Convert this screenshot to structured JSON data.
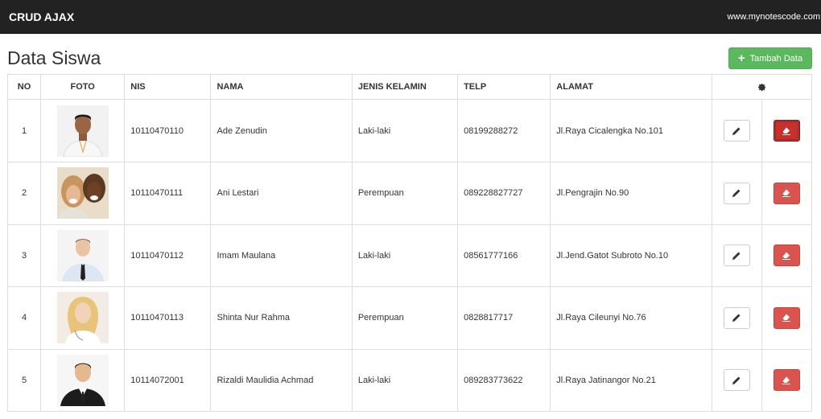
{
  "navbar": {
    "brand": "CRUD AJAX",
    "site": "www.mynotescode.com"
  },
  "page": {
    "title": "Data Siswa",
    "add_label": "Tambah Data"
  },
  "table": {
    "headers": {
      "no": "NO",
      "foto": "FOTO",
      "nis": "NIS",
      "nama": "NAMA",
      "jk": "JENIS KELAMIN",
      "telp": "TELP",
      "alamat": "ALAMAT",
      "actions_icon": "gear-icon"
    },
    "rows": [
      {
        "no": "1",
        "nis": "10110470110",
        "nama": "Ade Zenudin",
        "jk": "Laki-laki",
        "telp": "08199288272",
        "alamat": "Jl.Raya Cicalengka No.101"
      },
      {
        "no": "2",
        "nis": "10110470111",
        "nama": "Ani Lestari",
        "jk": "Perempuan",
        "telp": "089228827727",
        "alamat": "Jl.Pengrajin No.90"
      },
      {
        "no": "3",
        "nis": "10110470112",
        "nama": "Imam Maulana",
        "jk": "Laki-laki",
        "telp": "08561777166",
        "alamat": "Jl.Jend.Gatot Subroto No.10"
      },
      {
        "no": "4",
        "nis": "10110470113",
        "nama": "Shinta Nur Rahma",
        "jk": "Perempuan",
        "telp": "0828817717",
        "alamat": "Jl.Raya Cileunyi No.76"
      },
      {
        "no": "5",
        "nis": "10114072001",
        "nama": "Rizaldi Maulidia Achmad",
        "jk": "Laki-laki",
        "telp": "089283773622",
        "alamat": "Jl.Raya Jatinangor No.21"
      }
    ],
    "row_actions": {
      "edit_icon": "pencil-icon",
      "delete_icon": "eraser-icon"
    }
  },
  "colors": {
    "navbar": "#222222",
    "success": "#5cb85c",
    "danger": "#d9534f"
  }
}
